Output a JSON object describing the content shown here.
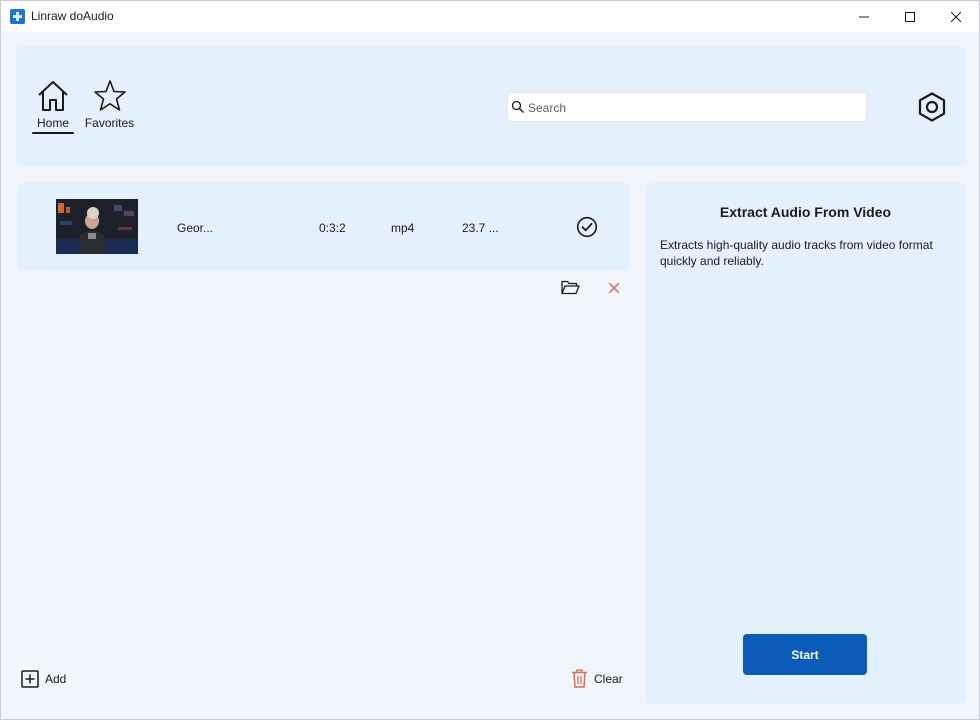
{
  "window": {
    "title": "Linraw doAudio"
  },
  "nav": {
    "home_label": "Home",
    "favorites_label": "Favorites"
  },
  "search": {
    "placeholder": "Search",
    "value": ""
  },
  "files": [
    {
      "name": "Geor...",
      "duration": "0:3:2",
      "format": "mp4",
      "size": "23.7 ...",
      "status": "check-circle-icon"
    }
  ],
  "actions": {
    "add_label": "Add",
    "clear_label": "Clear"
  },
  "panel": {
    "title": "Extract Audio From Video",
    "description": "Extracts high-quality audio tracks from video format quickly and reliably.",
    "start_label": "Start"
  },
  "colors": {
    "accent": "#0b5cb8",
    "panel_bg": "#e4f0fb",
    "window_bg": "#f1f6fd",
    "danger": "#e0694f"
  }
}
